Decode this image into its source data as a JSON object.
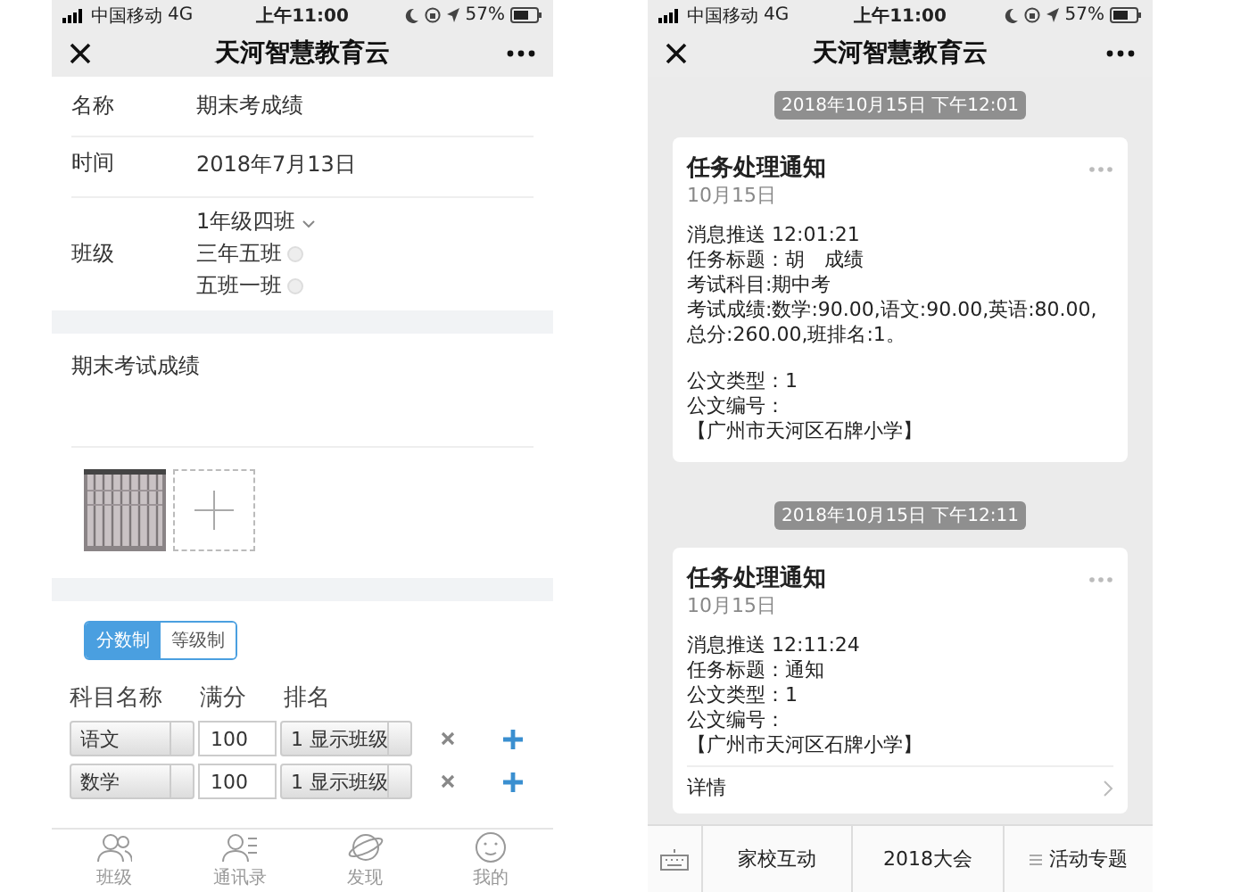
{
  "form_screen": {
    "status": {
      "carrier": "中国移动",
      "network": "4G",
      "time": "上午11:00",
      "battery": "57%"
    },
    "nav": {
      "title": "天河智慧教育云"
    },
    "fields": [
      {
        "label": "名称",
        "value": "期末考成绩"
      },
      {
        "label": "时间",
        "value": "2018年7月13日"
      }
    ],
    "classes": {
      "label": "班级",
      "options": [
        {
          "name": "1年级四班",
          "selected": true
        },
        {
          "name": "三年五班",
          "selected": false
        },
        {
          "name": "五班一班",
          "selected": false
        }
      ]
    },
    "description": "期末考试成绩",
    "attachments": [
      {
        "kind": "picture"
      },
      {
        "kind": "add"
      }
    ],
    "score_modes": [
      {
        "label": "分数制",
        "selected": true
      },
      {
        "label": "等级制",
        "selected": false
      }
    ],
    "subject_table": {
      "columns": [
        "科目名称",
        "满分",
        "排名"
      ],
      "rows": [
        {
          "subject": "语文",
          "full_score": "100",
          "rank": "1 显示班级"
        },
        {
          "subject": "数学",
          "full_score": "100",
          "rank": "1 显示班级"
        }
      ]
    },
    "tabs": [
      {
        "label": "班级",
        "kind": "people"
      },
      {
        "label": "通讯录",
        "kind": "contacts"
      },
      {
        "label": "发现",
        "kind": "planet"
      },
      {
        "label": "我的",
        "kind": "face"
      }
    ]
  },
  "message_screen": {
    "status": {
      "carrier": "中国移动",
      "network": "4G",
      "time": "上午11:00",
      "battery": "57%"
    },
    "nav": {
      "title": "天河智慧教育云"
    },
    "messages": [
      {
        "timestamp": "2018年10月15日 下午12:01",
        "title": "任务处理通知",
        "date": "10月15日",
        "paragraphs": [
          [
            "消息推送  12:01:21",
            "任务标题：胡　成绩",
            "考试科目:期中考",
            "考试成绩:数学:90.00,语文:90.00,英语:80.00,总分:260.00,班排名:1。"
          ],
          [
            "公文类型：1",
            "公文编号：",
            "【广州市天河区石牌小学】"
          ]
        ]
      },
      {
        "timestamp": "2018年10月15日 下午12:11",
        "title": "任务处理通知",
        "date": "10月15日",
        "paragraphs": [
          [
            "消息推送  12:11:24",
            "任务标题：通知",
            "公文类型：1",
            "公文编号：",
            "【广州市天河区石牌小学】"
          ]
        ],
        "link": "详情"
      }
    ],
    "menu": [
      {
        "label": "家校互动",
        "has_submenu": false
      },
      {
        "label": "2018大会",
        "has_submenu": false
      },
      {
        "label": "活动专题",
        "has_submenu": true
      }
    ]
  }
}
